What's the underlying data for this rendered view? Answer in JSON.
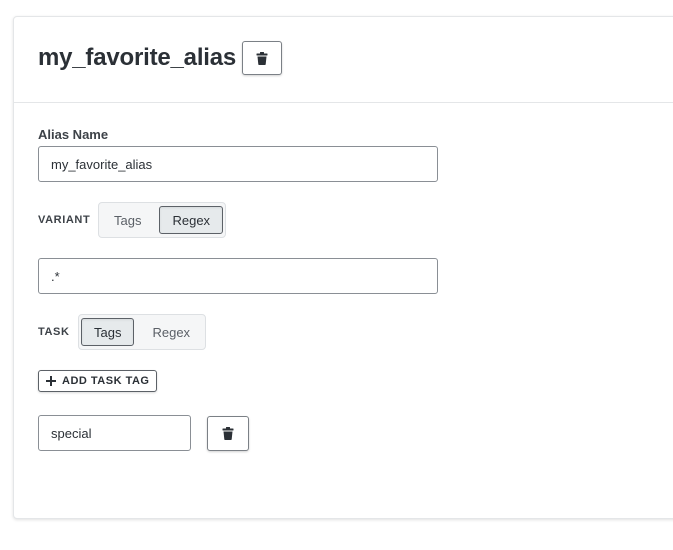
{
  "header": {
    "title": "my_favorite_alias"
  },
  "alias_name": {
    "label": "Alias Name",
    "value": "my_favorite_alias"
  },
  "variant": {
    "label": "VARIANT",
    "options": [
      "Tags",
      "Regex"
    ],
    "selected": "Regex"
  },
  "variant_regex": {
    "value": ".*"
  },
  "task": {
    "label": "TASK",
    "options": [
      "Tags",
      "Regex"
    ],
    "selected": "Tags"
  },
  "task_tags": {
    "add_label": "ADD TASK TAG",
    "tags": [
      {
        "value": "special"
      }
    ]
  },
  "icons": {
    "delete": "trash-icon",
    "add": "plus-icon"
  }
}
